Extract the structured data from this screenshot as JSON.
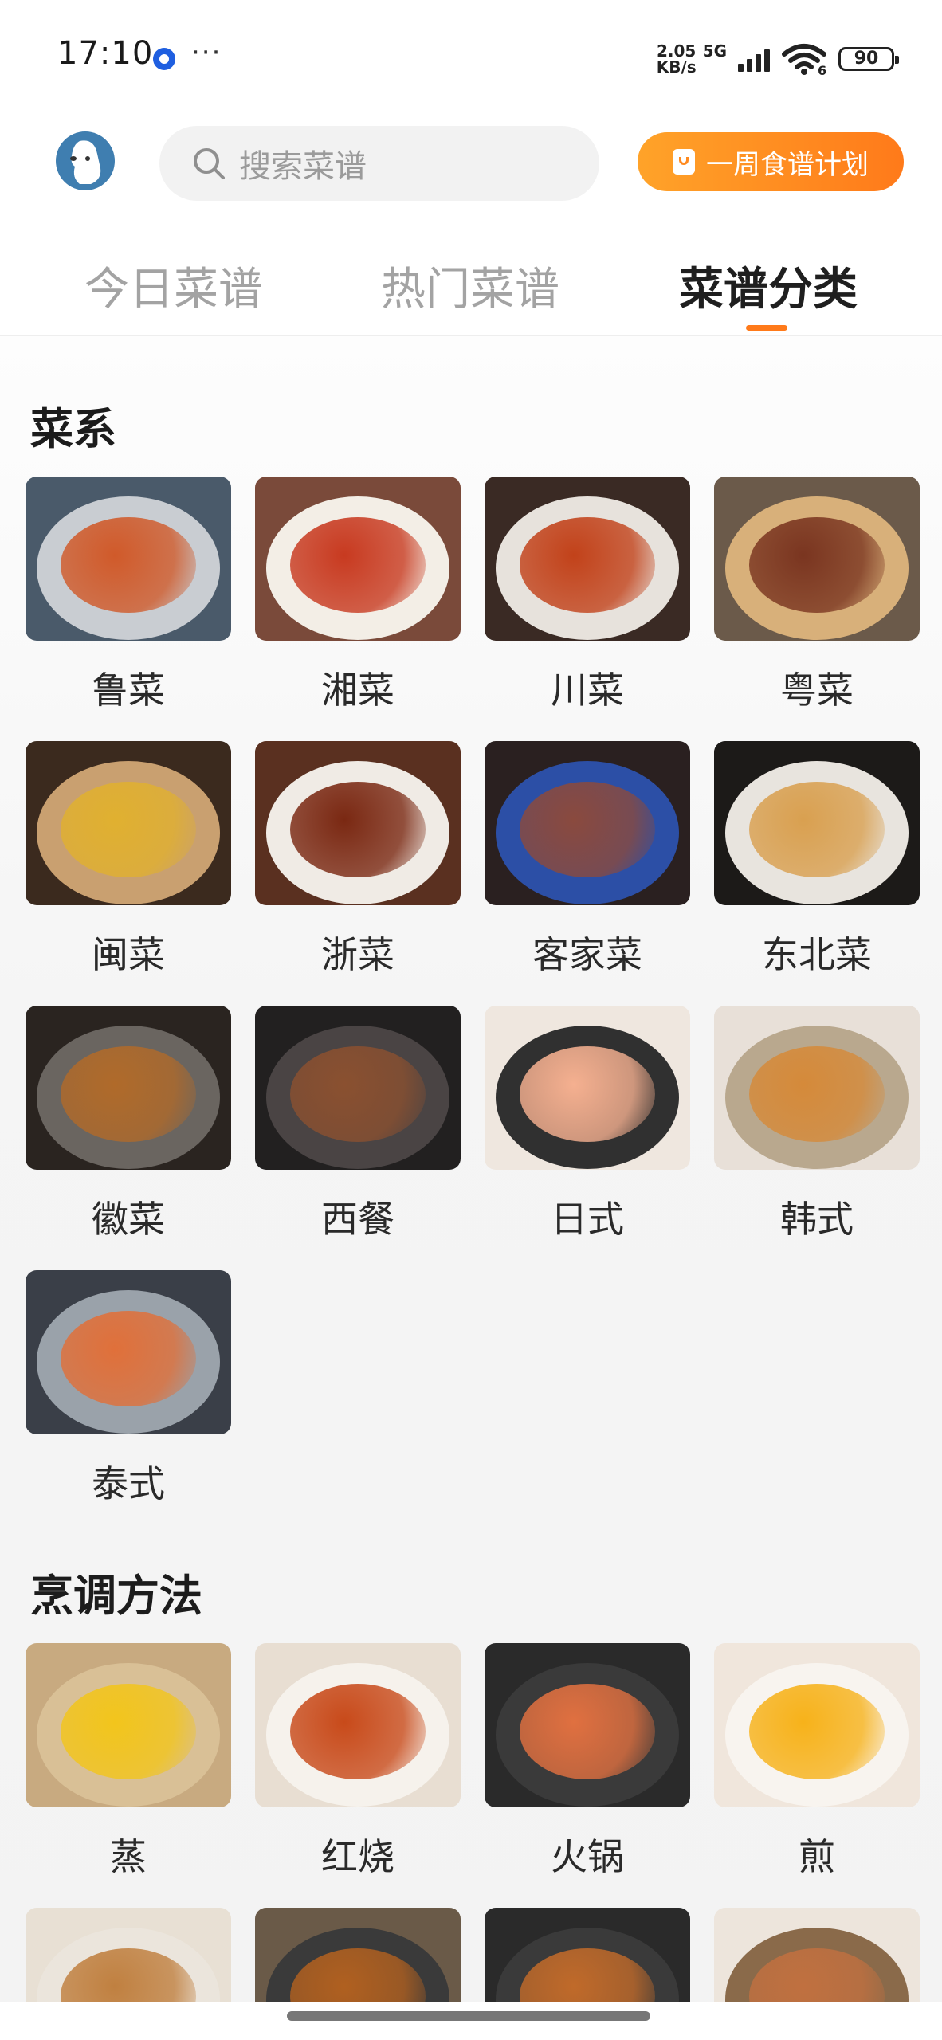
{
  "status_bar": {
    "time": "17:10",
    "dots": "···",
    "net_speed_value": "2.05",
    "net_speed_unit": "KB/s",
    "network_type": "5G",
    "wifi_badge": "6",
    "battery": "90"
  },
  "header": {
    "search_placeholder": "搜索菜谱",
    "plan_button_label": "一周食谱计划"
  },
  "tabs": [
    {
      "label": "今日菜谱"
    },
    {
      "label": "热门菜谱"
    },
    {
      "label": "菜谱分类"
    }
  ],
  "active_tab": "菜谱分类",
  "sections": {
    "cuisine": {
      "title": "菜系",
      "items": [
        {
          "label": "鲁菜"
        },
        {
          "label": "湘菜"
        },
        {
          "label": "川菜"
        },
        {
          "label": "粤菜"
        },
        {
          "label": "闽菜"
        },
        {
          "label": "浙菜"
        },
        {
          "label": "客家菜"
        },
        {
          "label": "东北菜"
        },
        {
          "label": "徽菜"
        },
        {
          "label": "西餐"
        },
        {
          "label": "日式"
        },
        {
          "label": "韩式"
        },
        {
          "label": "泰式"
        }
      ]
    },
    "method": {
      "title": "烹调方法",
      "items": [
        {
          "label": "蒸"
        },
        {
          "label": "红烧"
        },
        {
          "label": "火锅"
        },
        {
          "label": "煎"
        }
      ]
    }
  },
  "colors": {
    "accent": "#ff7a1a",
    "text": "#2a2a2a",
    "muted": "#a3a3a3"
  }
}
